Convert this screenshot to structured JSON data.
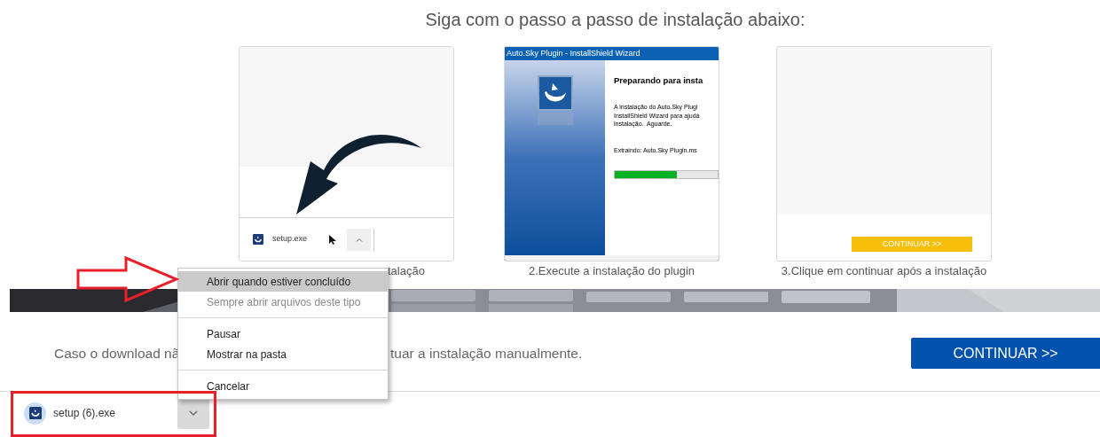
{
  "heading": "Siga com o passo a passo de instalação abaixo:",
  "steps": [
    {
      "kind": "download",
      "caption": "talação",
      "file": "setup.exe"
    },
    {
      "kind": "wizard",
      "caption": "2.Execute a instalação do plugin",
      "wizard": {
        "title": "Auto.Sky Plugin - InstallShield Wizard",
        "heading": "Preparando para insta",
        "lines": [
          "A instalação do Auto.Sky Plugi",
          "InstallShield Wizard para ajudá",
          "instalação.  Aguarde."
        ],
        "status": "Extraindo: Auto.Sky Plugin.ms",
        "level": 0.6
      }
    },
    {
      "kind": "continue",
      "caption": "3.Clique em continuar após a instalação",
      "button": "CONTINUAR >>"
    }
  ],
  "notice": {
    "before": "Caso o download nã",
    "after": "tuar a instalação manualmente."
  },
  "continue_button": "CONTINUAR >>",
  "download_bar": {
    "file": "setup (6).exe"
  },
  "context_menu": {
    "items": [
      {
        "kind": "item",
        "label": "Abrir quando estiver concluído",
        "highlighted": true,
        "disabled": false
      },
      {
        "kind": "item",
        "label": "Sempre abrir arquivos deste tipo",
        "highlighted": false,
        "disabled": true
      },
      {
        "kind": "separator"
      },
      {
        "kind": "item",
        "label": "Pausar",
        "highlighted": false,
        "disabled": false
      },
      {
        "kind": "item",
        "label": "Mostrar na pasta",
        "highlighted": false,
        "disabled": false
      },
      {
        "kind": "separator"
      },
      {
        "kind": "item",
        "label": "Cancelar",
        "highlighted": false,
        "disabled": false
      }
    ]
  }
}
